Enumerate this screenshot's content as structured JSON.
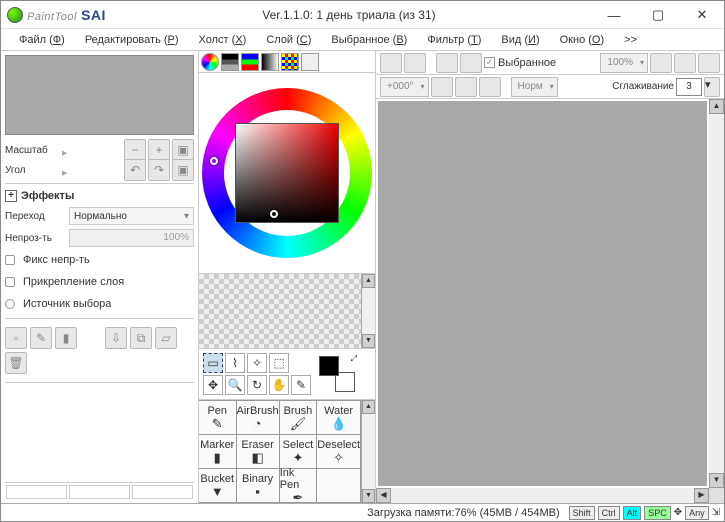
{
  "app": {
    "painttool": "PaintTool",
    "sai": "SAI"
  },
  "version": "Ver.1.1.0: 1 день триала (из 31)",
  "win": {
    "min": "—",
    "max": "▢",
    "close": "✕"
  },
  "menu": {
    "file": "Файл (<u>Ф</u>)",
    "edit": "Редактировать (<u>Р</u>)",
    "canvas": "Холст (<u>Х</u>)",
    "layer": "Слой (<u>С</u>)",
    "select": "Выбранное (<u>В</u>)",
    "filter": "Фильтр (<u>Т</u>)",
    "view": "Вид (<u>И</u>)",
    "window": "Окно (<u>О</u>)",
    "more": ">>"
  },
  "left": {
    "scale": "Масштаб",
    "angle": "Угол",
    "effects": "Эффекты",
    "blend_lbl": "Переход",
    "blend_val": "Нормально",
    "opacity_lbl": "Непроз-ть",
    "opacity_val": "100%",
    "fix_opacity": "Фикс непр-ть",
    "clip_layer": "Прикрепление слоя",
    "select_src": "Источник выбора"
  },
  "brushes": [
    [
      "Pen",
      "AirBrush",
      "Brush",
      "Water"
    ],
    [
      "Marker",
      "Eraser",
      "Select",
      "Deselect"
    ],
    [
      "Bucket",
      "Binary",
      "Ink Pen",
      ""
    ]
  ],
  "right": {
    "selected": "Выбранное",
    "zoom": "100%",
    "rot": "+000°",
    "mode": "Норм",
    "smoothing_lbl": "Сглаживание",
    "smoothing_val": "3"
  },
  "status": {
    "memory": "Загрузка памяти:76% (45MB / 454MB)",
    "shift": "Shift",
    "ctrl": "Ctrl",
    "alt": "Alt",
    "spc": "SPC",
    "any": "Any"
  }
}
